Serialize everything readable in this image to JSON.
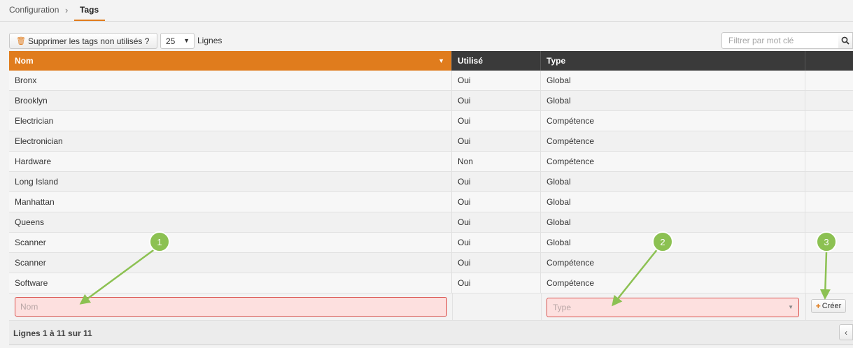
{
  "breadcrumb": {
    "parent": "Configuration",
    "separator": "›",
    "current": "Tags"
  },
  "toolbar": {
    "delete_unused_label": "Supprimer les tags non utilisés ?",
    "rows_per_page": "25",
    "rows_label": "Lignes",
    "filter_placeholder": "Filtrer par mot clé"
  },
  "table": {
    "columns": {
      "nom": "Nom",
      "utilise": "Utilisé",
      "type": "Type",
      "actions": ""
    },
    "rows": [
      {
        "nom": "Bronx",
        "utilise": "Oui",
        "type": "Global"
      },
      {
        "nom": "Brooklyn",
        "utilise": "Oui",
        "type": "Global"
      },
      {
        "nom": "Electrician",
        "utilise": "Oui",
        "type": "Compétence"
      },
      {
        "nom": "Electronician",
        "utilise": "Oui",
        "type": "Compétence"
      },
      {
        "nom": "Hardware",
        "utilise": "Non",
        "type": "Compétence"
      },
      {
        "nom": "Long Island",
        "utilise": "Oui",
        "type": "Global"
      },
      {
        "nom": "Manhattan",
        "utilise": "Oui",
        "type": "Global"
      },
      {
        "nom": "Queens",
        "utilise": "Oui",
        "type": "Global"
      },
      {
        "nom": "Scanner",
        "utilise": "Oui",
        "type": "Global"
      },
      {
        "nom": "Scanner",
        "utilise": "Oui",
        "type": "Compétence"
      },
      {
        "nom": "Software",
        "utilise": "Oui",
        "type": "Compétence"
      }
    ],
    "new_row": {
      "nom_placeholder": "Nom",
      "type_placeholder": "Type",
      "create_label": "Créer"
    }
  },
  "footer": {
    "summary": "Lignes 1 à 11 sur 11"
  },
  "annotations": {
    "markers": [
      "1",
      "2",
      "3"
    ]
  },
  "colors": {
    "accent": "#e07c1d",
    "header_bg": "#3a3a3a",
    "error_border": "#d9534f",
    "error_bg": "#fde0df",
    "annotation": "#8cc152"
  }
}
